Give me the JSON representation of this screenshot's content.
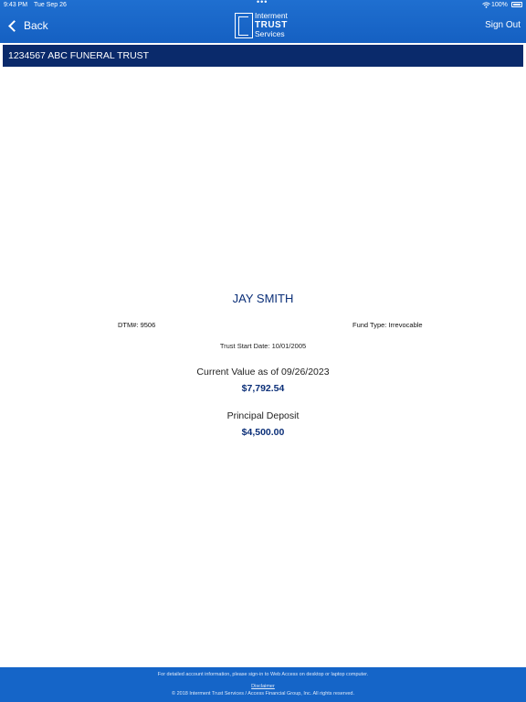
{
  "status_bar": {
    "time": "9:43 PM",
    "date": "Tue Sep 26",
    "dots": "•••",
    "battery": "100%"
  },
  "nav": {
    "back_label": "Back",
    "logo": {
      "line1": "Interment",
      "line2": "TRUST",
      "line3": "Services"
    },
    "signout_label": "Sign Out"
  },
  "account": {
    "title": "1234567 ABC FUNERAL TRUST"
  },
  "trust": {
    "name": "JAY SMITH",
    "dtm": "DTM#: 9506",
    "fund_type": "Fund Type: Irrevocable",
    "start_date": "Trust Start Date: 10/01/2005",
    "current_value_label": "Current Value as of 09/26/2023",
    "current_value": "$7,792.54",
    "principal_label": "Principal Deposit",
    "principal_value": "$4,500.00"
  },
  "footer": {
    "info": "For detailed account information, please sign-in to Web Access on desktop or laptop computer.",
    "disclaimer": "Disclaimer",
    "copyright": "© 2018 Interment Trust Services / Access Financial Group, Inc. All rights reserved."
  },
  "colors": {
    "header_blue": "#1a66c9",
    "account_bar_navy": "#0a2a6b",
    "accent_navy": "#0b2f78"
  }
}
